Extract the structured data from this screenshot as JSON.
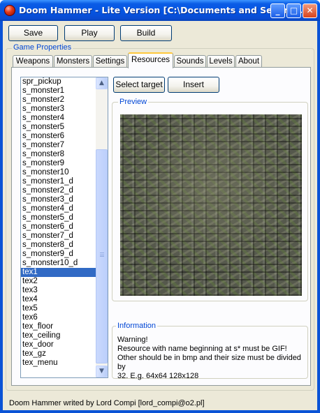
{
  "window": {
    "title": "Doom Hammer - Lite Version [C:\\Documents and Setting...",
    "min_glyph": "_",
    "max_glyph": "□",
    "close_glyph": "✕"
  },
  "toolbar": {
    "save_label": "Save",
    "play_label": "Play",
    "build_label": "Build"
  },
  "group": {
    "label": "Game Properties"
  },
  "tabs": [
    {
      "label": "Weapons"
    },
    {
      "label": "Monsters"
    },
    {
      "label": "Settings"
    },
    {
      "label": "Resources"
    },
    {
      "label": "Sounds"
    },
    {
      "label": "Levels"
    },
    {
      "label": "About"
    }
  ],
  "active_tab": "Resources",
  "resources": {
    "items": [
      "spr_pickup",
      "s_monster1",
      "s_monster2",
      "s_monster3",
      "s_monster4",
      "s_monster5",
      "s_monster6",
      "s_monster7",
      "s_monster8",
      "s_monster9",
      "s_monster10",
      "s_monster1_d",
      "s_monster2_d",
      "s_monster3_d",
      "s_monster4_d",
      "s_monster5_d",
      "s_monster6_d",
      "s_monster7_d",
      "s_monster8_d",
      "s_monster9_d",
      "s_monster10_d",
      "tex1",
      "tex2",
      "tex3",
      "tex4",
      "tex5",
      "tex6",
      "tex_floor",
      "tex_ceiling",
      "tex_door",
      "tex_gz",
      "tex_menu"
    ],
    "selected": "tex1",
    "scroll_up_glyph": "▲",
    "scroll_down_glyph": "▼",
    "select_target_label": "Select target",
    "insert_label": "Insert",
    "preview_label": "Preview",
    "information_label": "Information",
    "information_lines": [
      "Warning!",
      "Resource with name beginning at s* must be GIF!",
      "Other should be in bmp and their size must be divided by",
      "32. E.g. 64x64 128x128"
    ]
  },
  "status": {
    "text": "Doom Hammer writed by Lord Compi [lord_compi@o2.pl]"
  }
}
